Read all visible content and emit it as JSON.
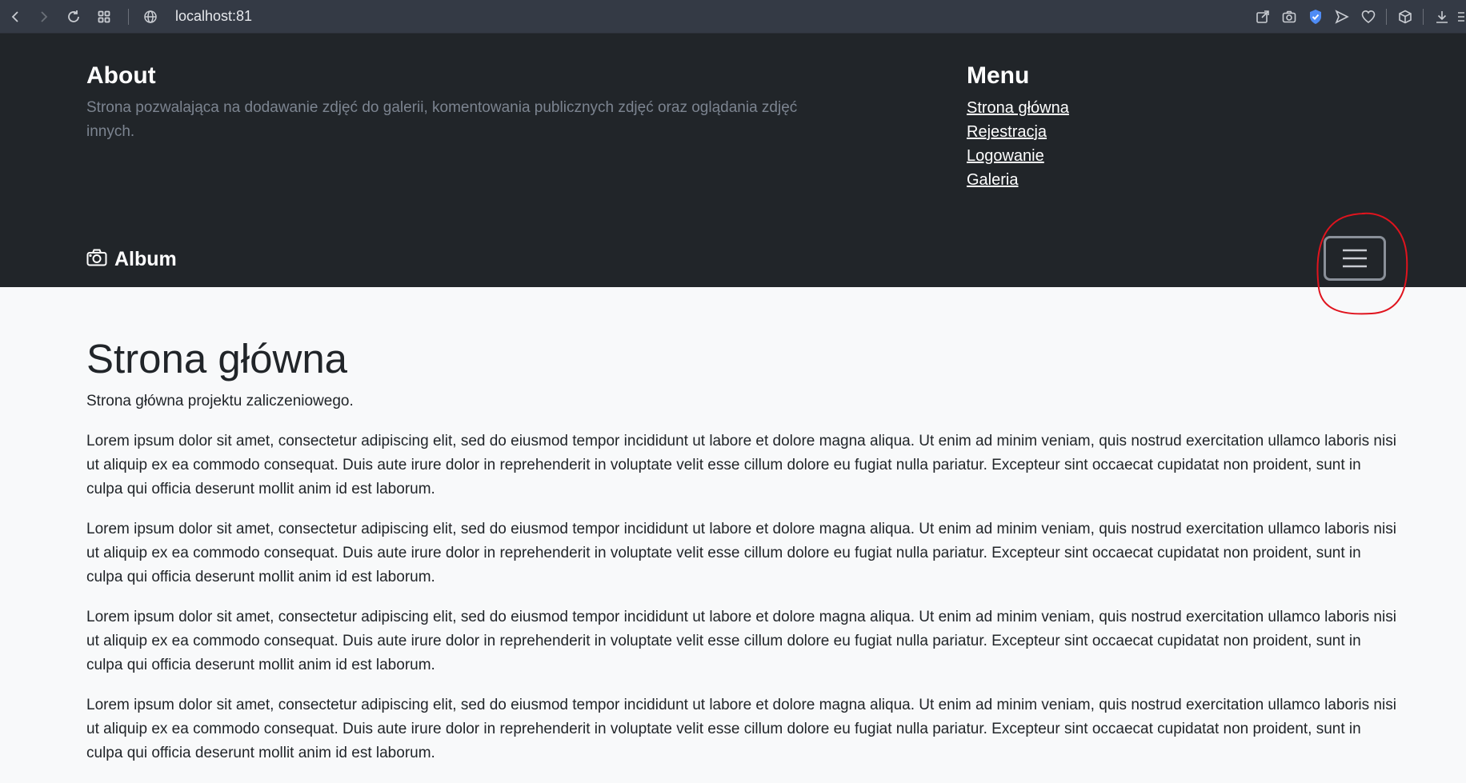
{
  "browser": {
    "url": "localhost:81"
  },
  "header": {
    "about_title": "About",
    "about_text": "Strona pozwalająca na dodawanie zdjęć do galerii, komentowania publicznych zdjęć oraz oglądania zdjęć innych.",
    "menu_title": "Menu",
    "menu_items": [
      {
        "label": "Strona główna"
      },
      {
        "label": "Rejestracja"
      },
      {
        "label": "Logowanie"
      },
      {
        "label": "Galeria"
      }
    ]
  },
  "navbar": {
    "brand_icon": "camera-icon",
    "brand_label": "Album",
    "toggler_icon": "hamburger-icon"
  },
  "main": {
    "title": "Strona główna",
    "lead": "Strona główna projektu zaliczeniowego.",
    "paragraphs": [
      "Lorem ipsum dolor sit amet, consectetur adipiscing elit, sed do eiusmod tempor incididunt ut labore et dolore magna aliqua. Ut enim ad minim veniam, quis nostrud exercitation ullamco laboris nisi ut aliquip ex ea commodo consequat. Duis aute irure dolor in reprehenderit in voluptate velit esse cillum dolore eu fugiat nulla pariatur. Excepteur sint occaecat cupidatat non proident, sunt in culpa qui officia deserunt mollit anim id est laborum.",
      "Lorem ipsum dolor sit amet, consectetur adipiscing elit, sed do eiusmod tempor incididunt ut labore et dolore magna aliqua. Ut enim ad minim veniam, quis nostrud exercitation ullamco laboris nisi ut aliquip ex ea commodo consequat. Duis aute irure dolor in reprehenderit in voluptate velit esse cillum dolore eu fugiat nulla pariatur. Excepteur sint occaecat cupidatat non proident, sunt in culpa qui officia deserunt mollit anim id est laborum.",
      "Lorem ipsum dolor sit amet, consectetur adipiscing elit, sed do eiusmod tempor incididunt ut labore et dolore magna aliqua. Ut enim ad minim veniam, quis nostrud exercitation ullamco laboris nisi ut aliquip ex ea commodo consequat. Duis aute irure dolor in reprehenderit in voluptate velit esse cillum dolore eu fugiat nulla pariatur. Excepteur sint occaecat cupidatat non proident, sunt in culpa qui officia deserunt mollit anim id est laborum.",
      "Lorem ipsum dolor sit amet, consectetur adipiscing elit, sed do eiusmod tempor incididunt ut labore et dolore magna aliqua. Ut enim ad minim veniam, quis nostrud exercitation ullamco laboris nisi ut aliquip ex ea commodo consequat. Duis aute irure dolor in reprehenderit in voluptate velit esse cillum dolore eu fugiat nulla pariatur. Excepteur sint occaecat cupidatat non proident, sunt in culpa qui officia deserunt mollit anim id est laborum."
    ]
  },
  "colors": {
    "header_bg": "#212529",
    "page_bg": "#f8f9fa",
    "muted_text": "#7c8490",
    "annotation": "#e0141e"
  }
}
